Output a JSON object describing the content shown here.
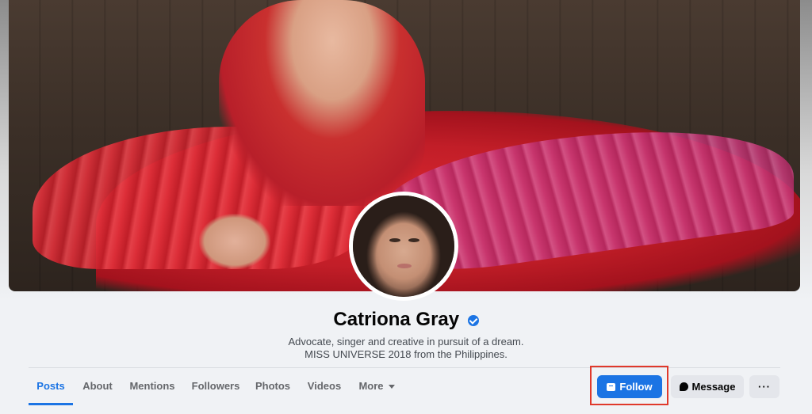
{
  "profile": {
    "name": "Catriona Gray",
    "verified": true,
    "bio_line1": "Advocate, singer and creative in pursuit of a dream.",
    "bio_line2": "MISS UNIVERSE 2018 from the Philippines."
  },
  "tabs": [
    {
      "label": "Posts",
      "active": true
    },
    {
      "label": "About"
    },
    {
      "label": "Mentions"
    },
    {
      "label": "Followers"
    },
    {
      "label": "Photos"
    },
    {
      "label": "Videos"
    },
    {
      "label": "More"
    }
  ],
  "actions": {
    "follow_label": "Follow",
    "message_label": "Message",
    "more_label": "···"
  },
  "colors": {
    "accent": "#1b74e4",
    "highlight_box": "#e0392b"
  },
  "icons": {
    "verified": "verified-badge-icon",
    "follow": "follow-icon",
    "message": "messenger-icon",
    "more_caret": "caret-down-icon"
  }
}
